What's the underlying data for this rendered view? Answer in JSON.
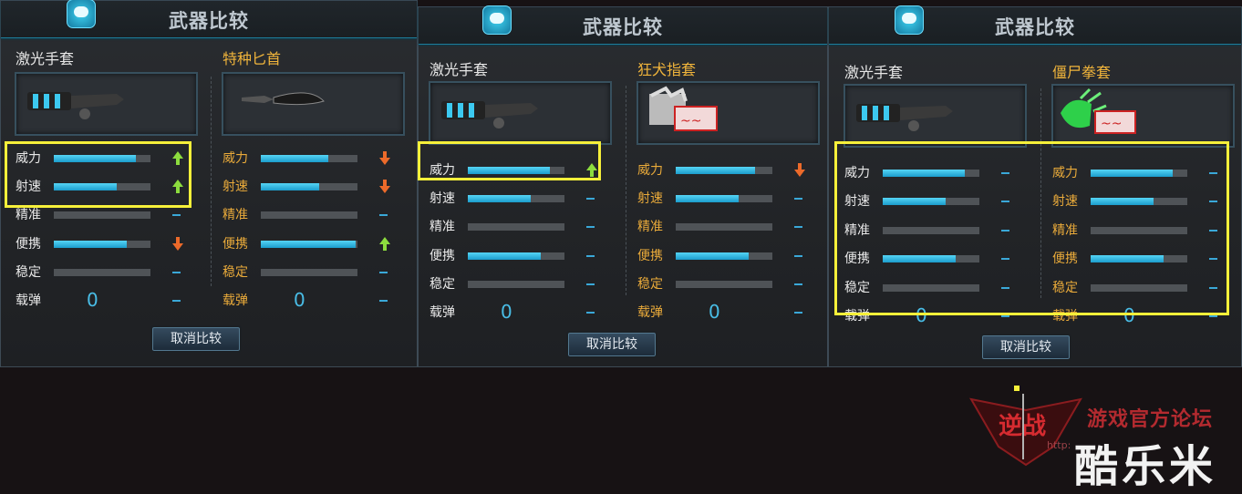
{
  "panels": [
    {
      "title": "武器比较",
      "cancel_label": "取消比较",
      "weapons": [
        {
          "name": "激光手套",
          "name_color": "white",
          "image": "laser-glove-icon"
        },
        {
          "name": "特种匕首",
          "name_color": "gold",
          "image": "special-dagger-icon"
        }
      ],
      "stat_labels": [
        "威力",
        "射速",
        "精准",
        "便携",
        "稳定",
        "载弹"
      ],
      "columns": [
        {
          "bars": [
            0.85,
            0.65,
            0.0,
            0.75,
            0.0
          ],
          "indicators": [
            "up",
            "up",
            "none",
            "down",
            "none",
            "none"
          ],
          "ammo": "0"
        },
        {
          "bars": [
            0.7,
            0.6,
            0.0,
            0.98,
            0.0
          ],
          "indicators": [
            "down",
            "down",
            "none",
            "up",
            "none",
            "none"
          ],
          "ammo": "0"
        }
      ]
    },
    {
      "title": "武器比较",
      "cancel_label": "取消比较",
      "weapons": [
        {
          "name": "激光手套",
          "name_color": "white",
          "image": "laser-glove-icon"
        },
        {
          "name": "狂犬指套",
          "name_color": "gold",
          "image": "mad-dog-knuckles-icon"
        }
      ],
      "stat_labels": [
        "威力",
        "射速",
        "精准",
        "便携",
        "稳定",
        "载弹"
      ],
      "columns": [
        {
          "bars": [
            0.85,
            0.65,
            0.0,
            0.75,
            0.0
          ],
          "indicators": [
            "up",
            "none",
            "none",
            "none",
            "none",
            "none"
          ],
          "ammo": "0"
        },
        {
          "bars": [
            0.82,
            0.65,
            0.0,
            0.75,
            0.0
          ],
          "indicators": [
            "down",
            "none",
            "none",
            "none",
            "none",
            "none"
          ],
          "ammo": "0"
        }
      ]
    },
    {
      "title": "武器比较",
      "cancel_label": "取消比较",
      "weapons": [
        {
          "name": "激光手套",
          "name_color": "white",
          "image": "laser-glove-icon"
        },
        {
          "name": "僵尸拳套",
          "name_color": "gold",
          "image": "zombie-gauntlet-icon"
        }
      ],
      "stat_labels": [
        "威力",
        "射速",
        "精准",
        "便携",
        "稳定",
        "载弹"
      ],
      "columns": [
        {
          "bars": [
            0.85,
            0.65,
            0.0,
            0.75,
            0.0
          ],
          "indicators": [
            "none",
            "none",
            "none",
            "none",
            "none",
            "none"
          ],
          "ammo": "0"
        },
        {
          "bars": [
            0.85,
            0.65,
            0.0,
            0.75,
            0.0
          ],
          "indicators": [
            "none",
            "none",
            "none",
            "none",
            "none",
            "none"
          ],
          "ammo": "0"
        }
      ]
    }
  ],
  "watermark": {
    "game_logo": "逆战",
    "forum_text": "游戏官方论坛",
    "site_text": "酷乐米",
    "url_fragment": "http:"
  },
  "colors": {
    "highlight": "#f6f03a",
    "bar_fill": "#2bb2e0",
    "arrow_up": "#8cdc3e",
    "arrow_down": "#ec6a2a",
    "gold_text": "#f0b43b"
  }
}
